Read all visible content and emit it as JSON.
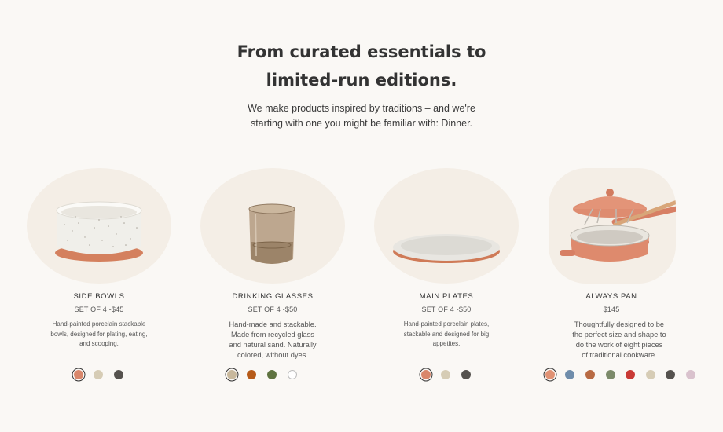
{
  "hero": {
    "title_line1": "From curated essentials to",
    "title_line2": "limited-run editions.",
    "subtitle_line1": "We make products inspired by traditions – and we're",
    "subtitle_line2": "starting with one you might be familiar with: Dinner."
  },
  "products": [
    {
      "name": "SIDE BOWLS",
      "price": "SET OF 4 -$45",
      "description": "Hand-painted porcelain stackable bowls, designed for plating, eating, and scooping.",
      "swatches": [
        "#d9876b",
        "#d6ccb5",
        "#55524e"
      ],
      "selected_swatch": 0
    },
    {
      "name": "DRINKING GLASSES",
      "price": "SET OF 4 -$50",
      "description": "Hand-made and stackable. Made from recycled glass and natural sand. Naturally colored, without dyes.",
      "swatches": [
        "#c8b89c",
        "#b65a18",
        "#5f7340",
        "#ffffff"
      ],
      "selected_swatch": 0
    },
    {
      "name": "MAIN PLATES",
      "price": "SET OF 4 -$50",
      "description": "Hand-painted porcelain plates, stackable and designed for big appetites.",
      "swatches": [
        "#d9876b",
        "#d6ccb5",
        "#55524e"
      ],
      "selected_swatch": 0
    },
    {
      "name": "ALWAYS PAN",
      "price": "$145",
      "description": "Thoughtfully designed to be the perfect size and shape to do the work of eight pieces of traditional cookware.",
      "swatches": [
        "#e09274",
        "#6f8dab",
        "#b86a43",
        "#7c8a6a",
        "#c93a35",
        "#d6ccb5",
        "#55524e",
        "#d9c2cd"
      ],
      "selected_swatch": 0
    }
  ]
}
